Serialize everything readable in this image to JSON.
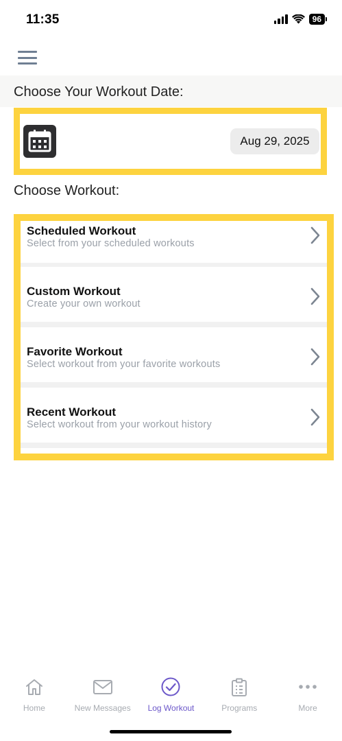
{
  "status_bar": {
    "time": "11:35",
    "battery": "96"
  },
  "sections": {
    "date_header": "Choose Your Workout Date:",
    "workout_header": "Choose Workout:"
  },
  "date": {
    "value": "Aug 29, 2025"
  },
  "workouts": [
    {
      "title": "Scheduled Workout",
      "subtitle": "Select from your scheduled workouts"
    },
    {
      "title": "Custom Workout",
      "subtitle": "Create your own workout"
    },
    {
      "title": "Favorite Workout",
      "subtitle": "Select workout from your favorite workouts"
    },
    {
      "title": "Recent Workout",
      "subtitle": "Select workout from your workout history"
    }
  ],
  "tabs": [
    {
      "label": "Home",
      "icon": "home-icon",
      "active": false
    },
    {
      "label": "New Messages",
      "icon": "mail-icon",
      "active": false
    },
    {
      "label": "Log Workout",
      "icon": "check-circle-icon",
      "active": true
    },
    {
      "label": "Programs",
      "icon": "clipboard-icon",
      "active": false
    },
    {
      "label": "More",
      "icon": "more-icon",
      "active": false
    }
  ],
  "colors": {
    "highlight": "#fdd33f",
    "accent": "#6b57c9",
    "inactive": "#a7abb1"
  }
}
